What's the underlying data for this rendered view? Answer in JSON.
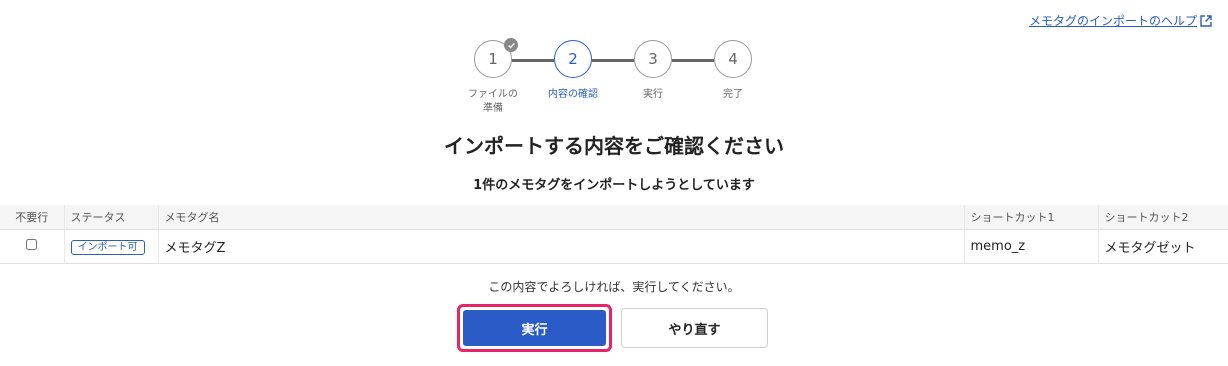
{
  "help_link": {
    "label": "メモタグのインポートのヘルプ"
  },
  "stepper": {
    "steps": [
      {
        "number": "1",
        "label_line1": "ファイルの",
        "label_line2": "準備",
        "state": "done"
      },
      {
        "number": "2",
        "label_line1": "内容の確認",
        "label_line2": "",
        "state": "active"
      },
      {
        "number": "3",
        "label_line1": "実行",
        "label_line2": "",
        "state": "pending"
      },
      {
        "number": "4",
        "label_line1": "完了",
        "label_line2": "",
        "state": "pending"
      }
    ]
  },
  "title": "インポートする内容をご確認ください",
  "subtitle": "1件のメモタグをインポートしようとしています",
  "table": {
    "headers": [
      "不要行",
      "ステータス",
      "メモタグ名",
      "ショートカット1",
      "ショートカット2"
    ],
    "rows": [
      {
        "checked": false,
        "status": "インポート可",
        "name": "メモタグZ",
        "shortcut1": "memo_z",
        "shortcut2": "メモタグゼット"
      }
    ]
  },
  "confirm_message": "この内容でよろしければ、実行してください。",
  "buttons": {
    "run": "実行",
    "redo": "やり直す"
  },
  "colors": {
    "accent": "#2a5fbf",
    "primary_button": "#2a5bc7",
    "highlight_border": "#e6246a"
  }
}
